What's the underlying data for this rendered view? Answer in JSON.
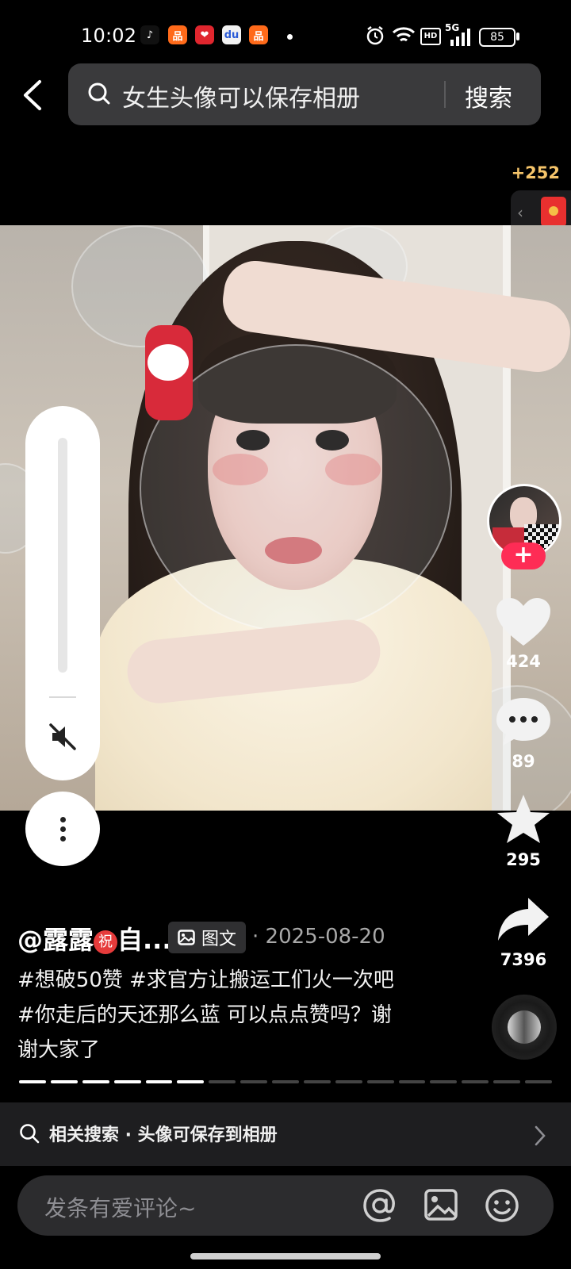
{
  "status_bar": {
    "time": "10:02",
    "battery": "85",
    "network": "5G",
    "hd": "HD",
    "app_icons": [
      "tiktok-icon",
      "app-store-icon",
      "red-app-icon",
      "baidu-icon",
      "orange-app-icon"
    ],
    "app_glyphs": [
      "♪",
      "品",
      "❤",
      "du",
      "品"
    ]
  },
  "search": {
    "query": "女生头像可以保存相册",
    "button": "搜索"
  },
  "reward": {
    "count": "+252"
  },
  "rail": {
    "likes": "424",
    "comments": "89",
    "favorites": "295",
    "shares": "7396",
    "follow_glyph": "+"
  },
  "post": {
    "author_prefix": "@露露",
    "author_badge": "祝",
    "author_suffix": "自...",
    "type_label": "图文",
    "date": "· 2025-08-20",
    "description": "#想破50赞 #求官方让搬运工们火一次吧 #你走后的天还那么蓝 可以点点赞吗？谢谢大家了",
    "progress_total": 17,
    "progress_current": 6
  },
  "related": {
    "label": "相关搜索 · 头像可保存到相册"
  },
  "comment": {
    "placeholder": "发条有爱评论~"
  },
  "colors": {
    "accent": "#fe2c55",
    "reward": "#f5c46a"
  }
}
